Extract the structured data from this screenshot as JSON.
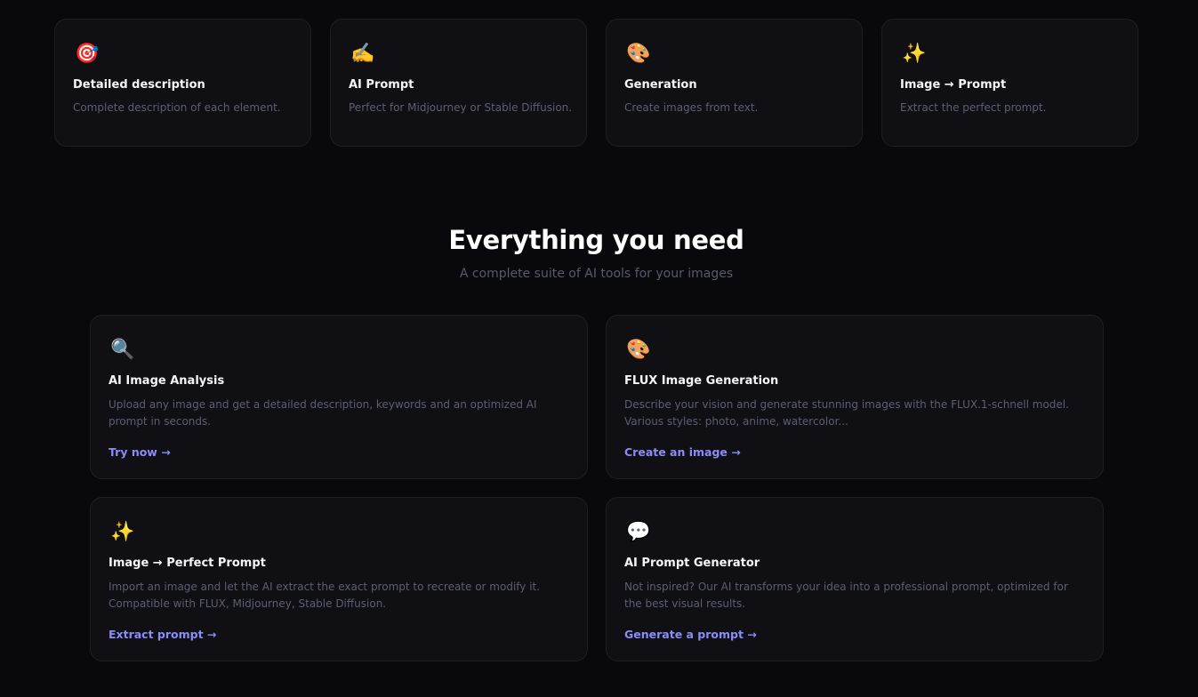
{
  "features": [
    {
      "icon": "🎯",
      "icon_name": "target-icon",
      "title": "Detailed description",
      "description": "Complete description of each element."
    },
    {
      "icon": "✍️",
      "icon_name": "writing-hand-icon",
      "title": "AI Prompt",
      "description": "Perfect for Midjourney or Stable Diffusion."
    },
    {
      "icon": "🎨",
      "icon_name": "palette-icon",
      "title": "Generation",
      "description": "Create images from text."
    },
    {
      "icon": "✨",
      "icon_name": "sparkles-icon",
      "title": "Image → Prompt",
      "description": "Extract the perfect prompt."
    }
  ],
  "section": {
    "title": "Everything you need",
    "subtitle": "A complete suite of AI tools for your images"
  },
  "tools": [
    {
      "icon": "🔍",
      "icon_name": "magnifier-icon",
      "title": "AI Image Analysis",
      "description": "Upload any image and get a detailed description, keywords and an optimized AI prompt in seconds.",
      "link": "Try now →"
    },
    {
      "icon": "🎨",
      "icon_name": "palette-icon",
      "title": "FLUX Image Generation",
      "description": "Describe your vision and generate stunning images with the FLUX.1-schnell model. Various styles: photo, anime, watercolor...",
      "link": "Create an image →"
    },
    {
      "icon": "✨",
      "icon_name": "sparkles-icon",
      "title": "Image → Perfect Prompt",
      "description": "Import an image and let the AI extract the exact prompt to recreate or modify it. Compatible with FLUX, Midjourney, Stable Diffusion.",
      "link": "Extract prompt →"
    },
    {
      "icon": "💬",
      "icon_name": "speech-bubble-icon",
      "title": "AI Prompt Generator",
      "description": "Not inspired? Our AI transforms your idea into a professional prompt, optimized for the best visual results.",
      "link": "Generate a prompt →"
    }
  ],
  "colors": {
    "background": "#09090d",
    "card": "#0f0f14",
    "card_border": "#1e1e26",
    "muted_text": "#5c5f6e",
    "accent_link": "#8b8cf8"
  }
}
